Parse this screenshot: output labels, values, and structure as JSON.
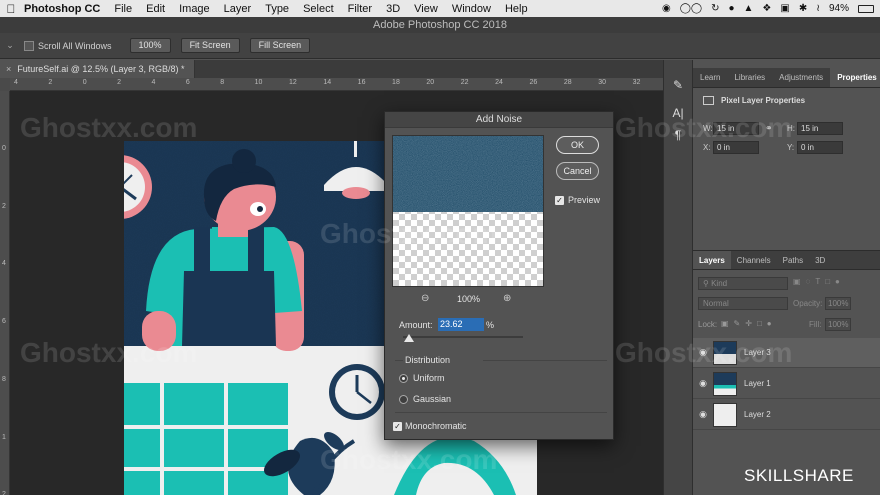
{
  "menubar": {
    "app_name": "Photoshop CC",
    "items": [
      "File",
      "Edit",
      "Image",
      "Layer",
      "Type",
      "Select",
      "Filter",
      "3D",
      "View",
      "Window",
      "Help"
    ],
    "battery": "94%"
  },
  "window_title": "Adobe Photoshop CC 2018",
  "options_bar": {
    "scroll_all_windows": "Scroll All Windows",
    "zoom_100": "100%",
    "fit_screen": "Fit Screen",
    "fill_screen": "Fill Screen"
  },
  "document_tab": "FutureSelf.ai @ 12.5% (Layer 3, RGB/8) *",
  "ruler_top_ticks": [
    "4",
    "2",
    "0",
    "2",
    "4",
    "6",
    "8",
    "10",
    "12",
    "14",
    "16",
    "18",
    "20",
    "22",
    "24",
    "26",
    "28",
    "30",
    "32"
  ],
  "ruler_left_ticks": [
    "0",
    "2",
    "4",
    "6",
    "8",
    "1",
    "2"
  ],
  "right_panel": {
    "tabs": [
      "Learn",
      "Libraries",
      "Adjustments",
      "Properties"
    ],
    "properties_title": "Pixel Layer Properties",
    "w_label": "W:",
    "w_value": "15 in",
    "h_label": "H:",
    "h_value": "15 in",
    "x_label": "X:",
    "x_value": "0 in",
    "y_label": "Y:",
    "y_value": "0 in"
  },
  "layers_panel": {
    "tabs": [
      "Layers",
      "Channels",
      "Paths",
      "3D"
    ],
    "kind": "Kind",
    "blend_mode": "Normal",
    "opacity_label": "Opacity:",
    "opacity_value": "100%",
    "lock_label": "Lock:",
    "fill_label": "Fill:",
    "fill_value": "100%",
    "layers": [
      {
        "name": "Layer 3",
        "selected": true
      },
      {
        "name": "Layer 1",
        "selected": false
      },
      {
        "name": "Layer 2",
        "selected": false
      }
    ]
  },
  "dialog": {
    "title": "Add Noise",
    "ok": "OK",
    "cancel": "Cancel",
    "preview_label": "Preview",
    "preview_checked": true,
    "zoom": "100%",
    "amount_label": "Amount:",
    "amount_value": "23.62",
    "amount_unit": "%",
    "amount_slider_fraction": 0.047,
    "distribution_label": "Distribution",
    "uniform_label": "Uniform",
    "gaussian_label": "Gaussian",
    "distribution_selected": "Uniform",
    "monochromatic_label": "Monochromatic",
    "monochromatic_checked": true
  },
  "watermark": "Ghostxx.com",
  "brand": "SKILLSHARE",
  "colors": {
    "navy": "#1d3b5a",
    "teal": "#1bbfb3",
    "pink": "#ea8a92",
    "light": "#eeeeee",
    "selection": "#2a6db5"
  }
}
